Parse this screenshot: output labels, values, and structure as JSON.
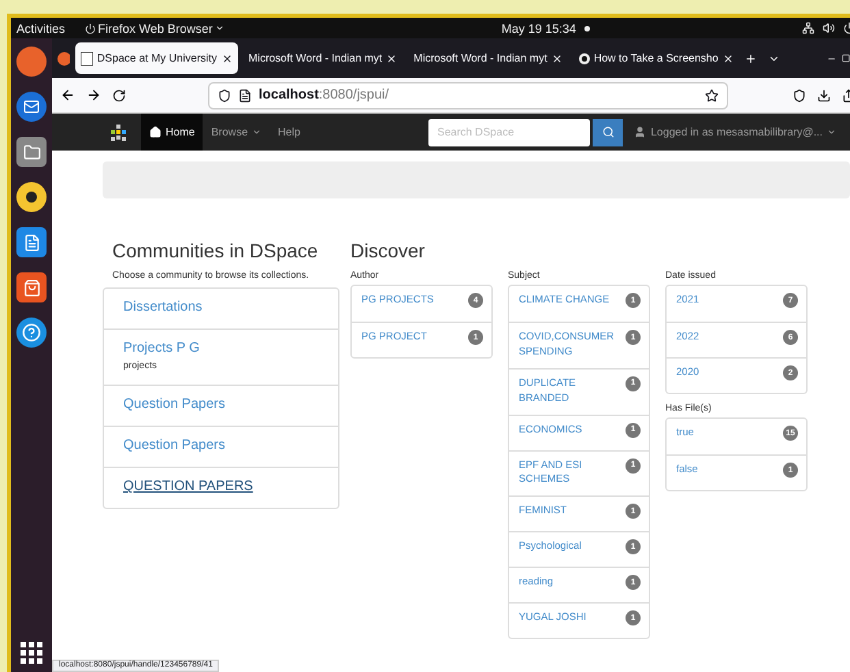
{
  "top_bar": {
    "activities": "Activities",
    "app_menu": "Firefox Web Browser",
    "clock": "May 19  15:34"
  },
  "tabs": [
    {
      "label": "DSpace at My University",
      "selected": true,
      "kind": "page"
    },
    {
      "label": "Microsoft Word - Indian myt",
      "selected": false,
      "kind": "plain"
    },
    {
      "label": "Microsoft Word - Indian myt",
      "selected": false,
      "kind": "plain"
    },
    {
      "label": "How to Take a Screensho",
      "selected": false,
      "kind": "video"
    }
  ],
  "address": {
    "host": "localhost",
    "path": ":8080/jspui/"
  },
  "navbar": {
    "items": [
      {
        "label": "Home",
        "selected": true,
        "kind": "home"
      },
      {
        "label": "Browse",
        "selected": false,
        "kind": "dropdown"
      },
      {
        "label": "Help",
        "selected": false,
        "kind": "plain"
      }
    ],
    "search_placeholder": "Search DSpace",
    "user": "Logged in as mesasmabilibrary@..."
  },
  "communities": {
    "heading": "Communities in DSpace",
    "intro": "Choose a community to browse its collections.",
    "items": [
      {
        "name": "Dissertations",
        "hovered": false
      },
      {
        "name": "Projects P G",
        "description": "projects",
        "hovered": false
      },
      {
        "name": "Question Papers",
        "hovered": false
      },
      {
        "name": "Question Papers",
        "hovered": false
      },
      {
        "name": "QUESTION PAPERS",
        "hovered": true
      }
    ]
  },
  "discover": {
    "heading": "Discover",
    "columns": [
      [
        {
          "title": "Author",
          "items": [
            {
              "label": "PG PROJECTS",
              "count": "4"
            },
            {
              "label": "PG PROJECT",
              "count": "1"
            }
          ]
        }
      ],
      [
        {
          "title": "Subject",
          "items": [
            {
              "label": "CLIMATE CHANGE",
              "count": "1"
            },
            {
              "label": "COVID,CONSUMER SPENDING",
              "count": "1"
            },
            {
              "label": "DUPLICATE BRANDED",
              "count": "1"
            },
            {
              "label": "ECONOMICS",
              "count": "1"
            },
            {
              "label": "EPF AND ESI SCHEMES",
              "count": "1"
            },
            {
              "label": "FEMINIST",
              "count": "1"
            },
            {
              "label": "Psychological",
              "count": "1"
            },
            {
              "label": "reading",
              "count": "1"
            },
            {
              "label": "YUGAL JOSHI",
              "count": "1"
            }
          ]
        }
      ],
      [
        {
          "title": "Date issued",
          "items": [
            {
              "label": "2021",
              "count": "7"
            },
            {
              "label": "2022",
              "count": "6"
            },
            {
              "label": "2020",
              "count": "2"
            }
          ]
        },
        {
          "title": "Has File(s)",
          "items": [
            {
              "label": "true",
              "count": "15"
            },
            {
              "label": "false",
              "count": "1"
            }
          ]
        }
      ]
    ]
  },
  "status_url": "localhost:8080/jspui/handle/123456789/41"
}
